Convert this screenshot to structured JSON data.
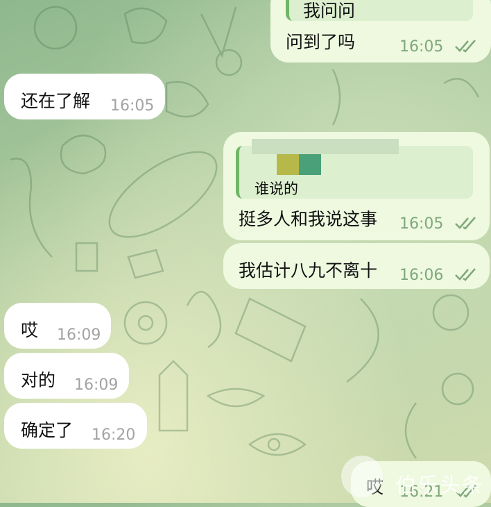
{
  "colors": {
    "incoming_bubble": "#ffffff",
    "outgoing_bubble": "#eef9e0",
    "reply_bar": "#6fb665",
    "read_check": "#7fa87a",
    "censor_block_yellow": "#b6b94a",
    "censor_block_green": "#4aa079"
  },
  "messages": [
    {
      "side": "out",
      "reply_to": "我问问",
      "text": "问到了吗",
      "time": "16:05",
      "status": "read-double-check-icon"
    },
    {
      "side": "in",
      "text": "还在了解",
      "time": "16:05"
    },
    {
      "side": "out",
      "reply_to": "谁说的",
      "text": "挺多人和我说这事",
      "time": "16:05",
      "status": "read-double-check-icon"
    },
    {
      "side": "out",
      "text": "我估计八九不离十",
      "time": "16:06",
      "status": "read-double-check-icon"
    },
    {
      "side": "in",
      "text": "哎",
      "time": "16:09"
    },
    {
      "side": "in",
      "text": "对的",
      "time": "16:09"
    },
    {
      "side": "in",
      "text": "确定了",
      "time": "16:20"
    },
    {
      "side": "out",
      "text": "哎",
      "time": "16:21",
      "status": "read-double-check-icon"
    }
  ],
  "watermark": {
    "text": "伯乐头条",
    "logo": "watermark-logo-icon"
  }
}
